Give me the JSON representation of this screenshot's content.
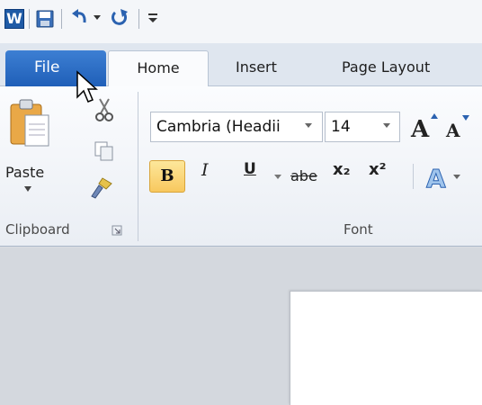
{
  "quick_access": {
    "app_icon_letter": "W",
    "icons": [
      "save-icon",
      "undo-icon",
      "redo-icon",
      "customize-dropdown-icon"
    ]
  },
  "tabs": {
    "file": "File",
    "home": "Home",
    "insert": "Insert",
    "page_layout": "Page Layout"
  },
  "clipboard": {
    "paste_label": "Paste",
    "group_label": "Clipboard"
  },
  "font": {
    "font_name": "Cambria (Headii",
    "font_size": "14",
    "bold_label": "B",
    "italic_label": "I",
    "underline_label": "U",
    "strike_label": "abe",
    "subscript_label": "x₂",
    "superscript_label": "x²",
    "group_label": "Font"
  },
  "colors": {
    "file_tab": "#2a6cc4",
    "bold_active": "#f8c85e",
    "accent": "#1f5ba6"
  }
}
